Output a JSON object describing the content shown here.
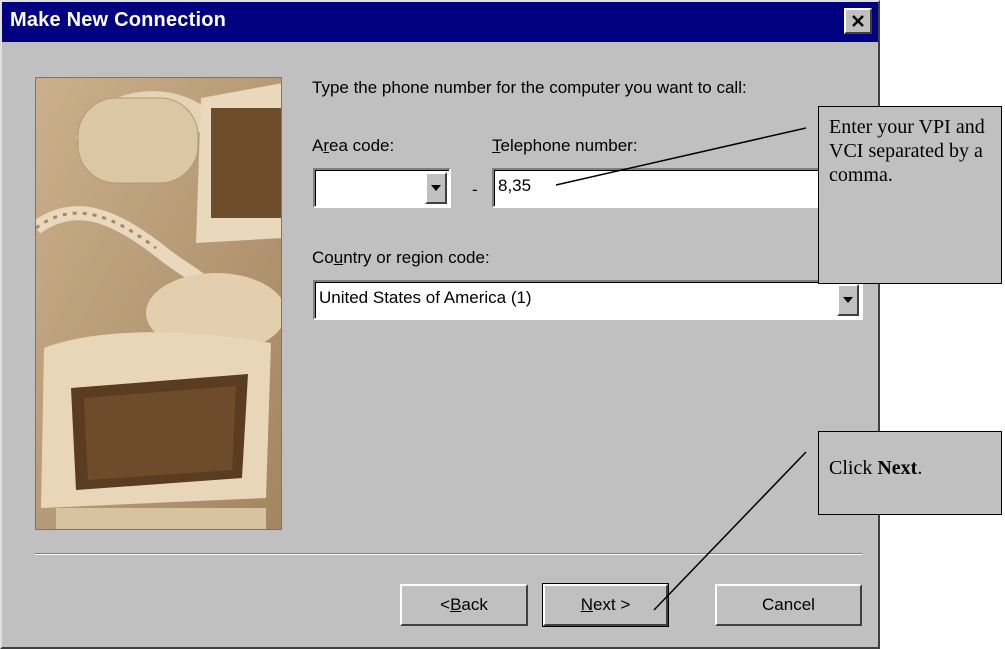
{
  "window": {
    "title": "Make New Connection"
  },
  "instruction": "Type the phone number for the computer you want to call:",
  "area_code": {
    "label_pre": "A",
    "label_key": "r",
    "label_post": "ea code:",
    "value": ""
  },
  "separator": "-",
  "telephone": {
    "label_key": "T",
    "label_post": "elephone number:",
    "value": "8,35"
  },
  "country": {
    "label_pre": "Co",
    "label_key": "u",
    "label_post": "ntry or region code:",
    "value": "United States of America (1)"
  },
  "buttons": {
    "back": {
      "pre": "< ",
      "key": "B",
      "post": "ack"
    },
    "next": {
      "key": "N",
      "post": "ext >"
    },
    "cancel": "Cancel"
  },
  "callouts": {
    "vpi": "Enter your VPI and VCI separated by a comma.",
    "next_pre": "Click ",
    "next_bold": "Next",
    "next_post": "."
  },
  "colors": {
    "titlebar": "#000080",
    "face": "#c0c0c0",
    "illustration": "#ba9f7a"
  },
  "icons": [
    "close-icon",
    "chevron-down-icon"
  ]
}
